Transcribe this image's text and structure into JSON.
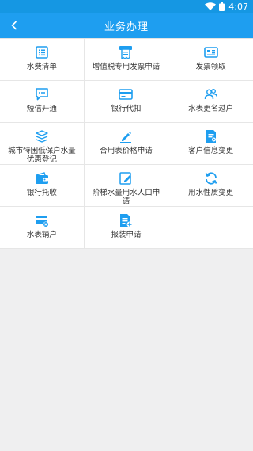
{
  "status": {
    "time": "4:07"
  },
  "appbar": {
    "title": "业务办理"
  },
  "colors": {
    "primary": "#1e9ef0",
    "icon": "#1e9ef0"
  },
  "services": [
    {
      "label": "水费清单",
      "icon": "bill-list-icon"
    },
    {
      "label": "增值税专用发票申请",
      "icon": "invoice-receipt-icon"
    },
    {
      "label": "发票领取",
      "icon": "invoice-card-icon"
    },
    {
      "label": "短信开通",
      "icon": "sms-bubble-icon"
    },
    {
      "label": "银行代扣",
      "icon": "bank-card-icon"
    },
    {
      "label": "水表更名过户",
      "icon": "users-transfer-icon"
    },
    {
      "label": "城市特困低保户水量优惠登记",
      "icon": "stack-coins-icon"
    },
    {
      "label": "合用表价格申请",
      "icon": "pen-edit-icon"
    },
    {
      "label": "客户信息变更",
      "icon": "document-edit-icon"
    },
    {
      "label": "银行托收",
      "icon": "wallet-icon"
    },
    {
      "label": "阶梯水量用水人口申请",
      "icon": "form-edit-icon"
    },
    {
      "label": "用水性质变更",
      "icon": "refresh-icon"
    },
    {
      "label": "水表销户",
      "icon": "card-cancel-icon"
    },
    {
      "label": "报装申请",
      "icon": "apply-document-icon"
    }
  ]
}
